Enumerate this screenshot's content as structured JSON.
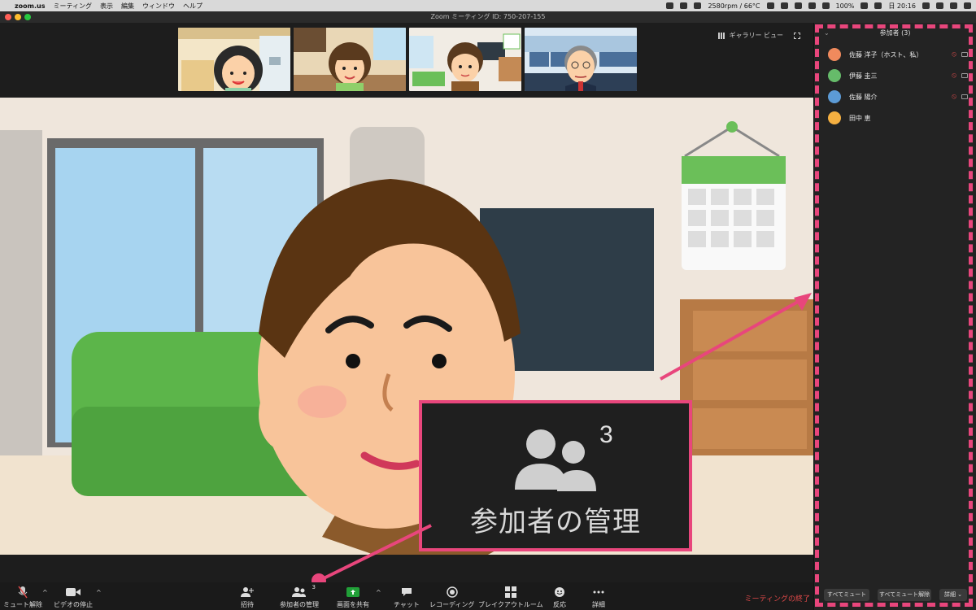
{
  "menubar": {
    "app": "zoom.us",
    "items": [
      "ミーティング",
      "表示",
      "編集",
      "ウィンドウ",
      "ヘルプ"
    ],
    "status_text": "2580rpm / 66°C",
    "battery": "100%",
    "clock": "日 20:16"
  },
  "window": {
    "title": "Zoom ミーティング ID: 750-207-155"
  },
  "view": {
    "gallery_label": "ギャラリー ビュー"
  },
  "callout": {
    "count": "3",
    "label": "参加者の管理"
  },
  "toolbar": {
    "unmute": "ミュート解除",
    "stop_video": "ビデオの停止",
    "invite": "招待",
    "manage_participants": "参加者の管理",
    "participants_count": "3",
    "share": "画面を共有",
    "chat": "チャット",
    "record": "レコーディング",
    "breakout": "ブレイクアウトルーム",
    "reactions": "反応",
    "more": "詳細",
    "end_meeting": "ミーティングの終了"
  },
  "panel": {
    "title": "参加者 (3)",
    "participants": [
      {
        "name": "佐藤 洋子（ホスト、私）",
        "avatar_color": "#f08a5d",
        "muted": true
      },
      {
        "name": "伊藤 圭三",
        "avatar_color": "#66bb6a",
        "muted": true
      },
      {
        "name": "佐藤 陽介",
        "avatar_color": "#5c9bd6",
        "muted": true
      },
      {
        "name": "田中 恵",
        "avatar_color": "#f5b041",
        "muted": false
      }
    ],
    "mute_all": "すべてミュート",
    "unmute_all": "すべてミュート解除",
    "more": "詳細"
  },
  "colors": {
    "accent": "#e8467c",
    "end": "#e24a4a",
    "share_green": "#21a038"
  }
}
